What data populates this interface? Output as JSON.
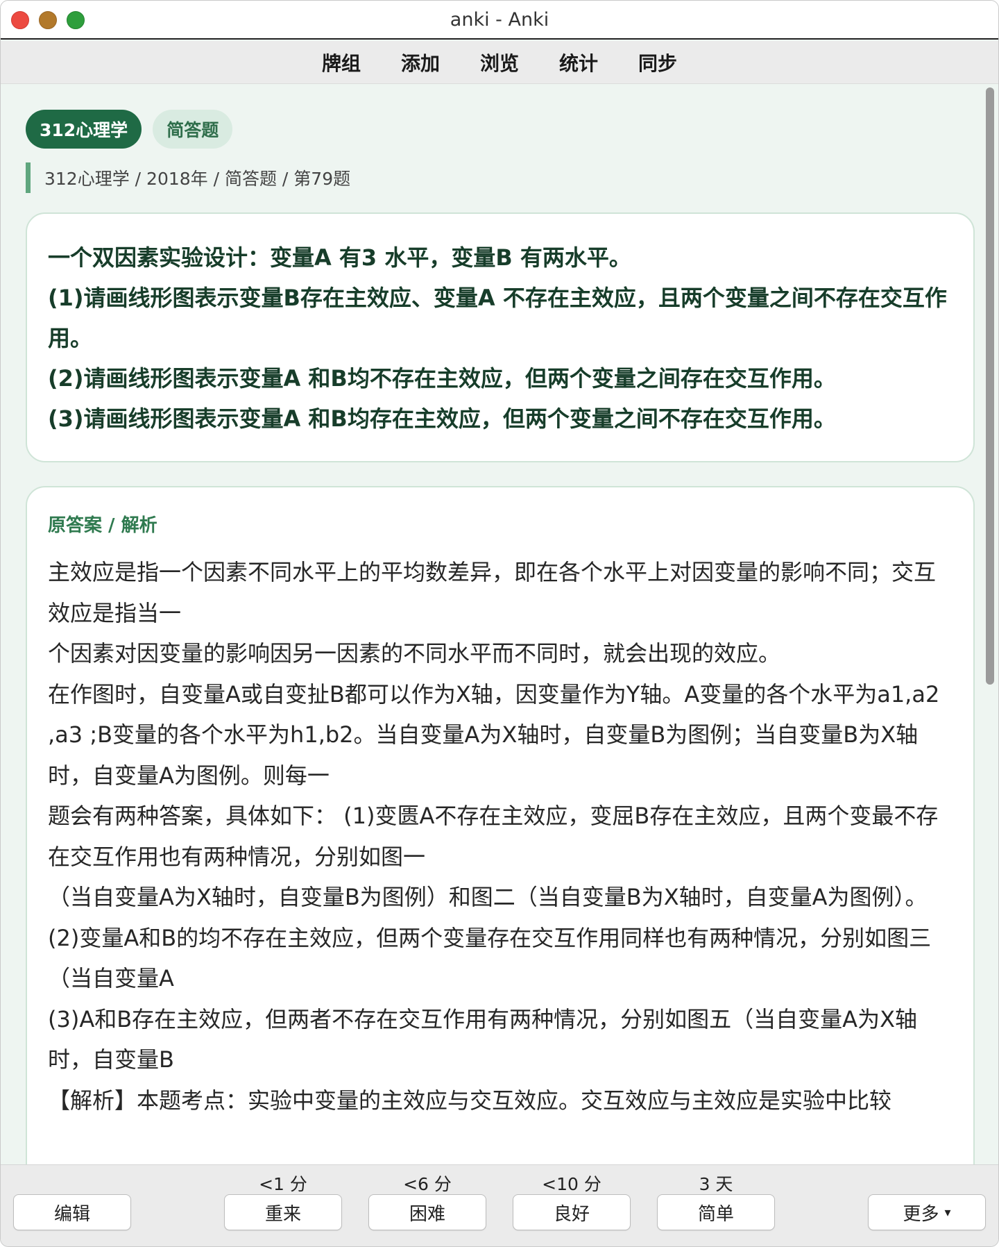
{
  "window": {
    "title": "anki - Anki"
  },
  "toolbar": {
    "decks": "牌组",
    "add": "添加",
    "browse": "浏览",
    "stats": "统计",
    "sync": "同步"
  },
  "card": {
    "tags": [
      "312心理学",
      "简答题"
    ],
    "breadcrumb": "312心理学 / 2018年 / 简答题 / 第79题",
    "question_lines": [
      "一个双因素实验设计：变量A 有3 水平，变量B 有两水平。",
      "(1)请画线形图表示变量B存在主效应、变量A 不存在主效应，且两个变量之间不存在交互作用。",
      "(2)请画线形图表示变量A 和B均不存在主效应，但两个变量之间存在交互作用。",
      "(3)请画线形图表示变量A 和B均存在主效应，但两个变量之间不存在交互作用。"
    ],
    "answer_heading": "原答案 / 解析",
    "answer_lines": [
      "主效应是指一个因素不同水平上的平均数差异，即在各个水平上对因变量的影响不同；交互效应是指当一",
      "个因素对因变量的影响因另一因素的不同水平而不同时，就会出现的效应。",
      "在作图时，自变量A或自变扯B都可以作为X轴，因变量作为Y轴。A变量的各个水平为a1,a2 ,a3 ;B变量的各个水平为h1,b2。当自变量A为X轴时，自变量B为图例；当自变量B为X轴时，自变量A为图例。则每一",
      "题会有两种答案，具体如下： (1)变匮A不存在主效应，变屈B存在主效应，且两个变最不存在交互作用也有两种情况，分别如图一",
      "（当自变量A为X轴时，自变量B为图例）和图二（当自变量B为X轴时，自变量A为图例）。",
      "(2)变量A和B的均不存在主效应，但两个变量存在交互作用同样也有两种情况，分别如图三（当自变量A",
      "(3)A和B存在主效应，但两者不存在交互作用有两种情况，分别如图五（当自变量A为X轴时，自变量B",
      "【解析】本题考点：实验中变量的主效应与交互效应。交互效应与主效应是实验中比较"
    ]
  },
  "bottom": {
    "edit": "编辑",
    "more": "更多",
    "more_caret": "▾",
    "ease": [
      {
        "interval": "<1 分",
        "label": "重来"
      },
      {
        "interval": "<6 分",
        "label": "困难"
      },
      {
        "interval": "<10 分",
        "label": "良好"
      },
      {
        "interval": "3 天",
        "label": "简单"
      }
    ]
  },
  "colors": {
    "accent": "#1f6a45",
    "tag_secondary_bg": "#d9ebe1",
    "background": "#eef5f1"
  }
}
